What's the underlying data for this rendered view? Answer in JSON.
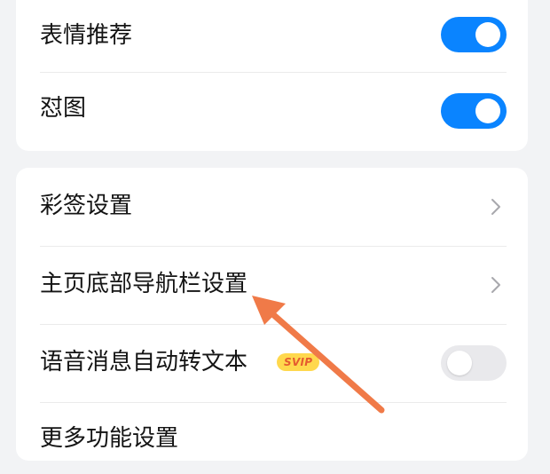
{
  "settings": {
    "sticker_recommend": {
      "label": "表情推荐",
      "enabled": true
    },
    "meme_reply": {
      "label": "怼图",
      "enabled": true
    },
    "color_tag_settings": {
      "label": "彩签设置"
    },
    "bottom_nav_settings": {
      "label": "主页底部导航栏设置"
    },
    "voice_to_text": {
      "label": "语音消息自动转文本",
      "badge": "SVIP",
      "enabled": false
    },
    "more_features": {
      "label": "更多功能设置"
    }
  },
  "colors": {
    "toggle_on": "#0a84ff",
    "toggle_off": "#e9e9ec",
    "annotation_arrow": "#f07a48",
    "badge_bg": "#ffd84d",
    "badge_text": "#e55b2f"
  },
  "icons": {
    "chevron": "chevron-right-icon",
    "annotation": "annotation-arrow-icon"
  }
}
